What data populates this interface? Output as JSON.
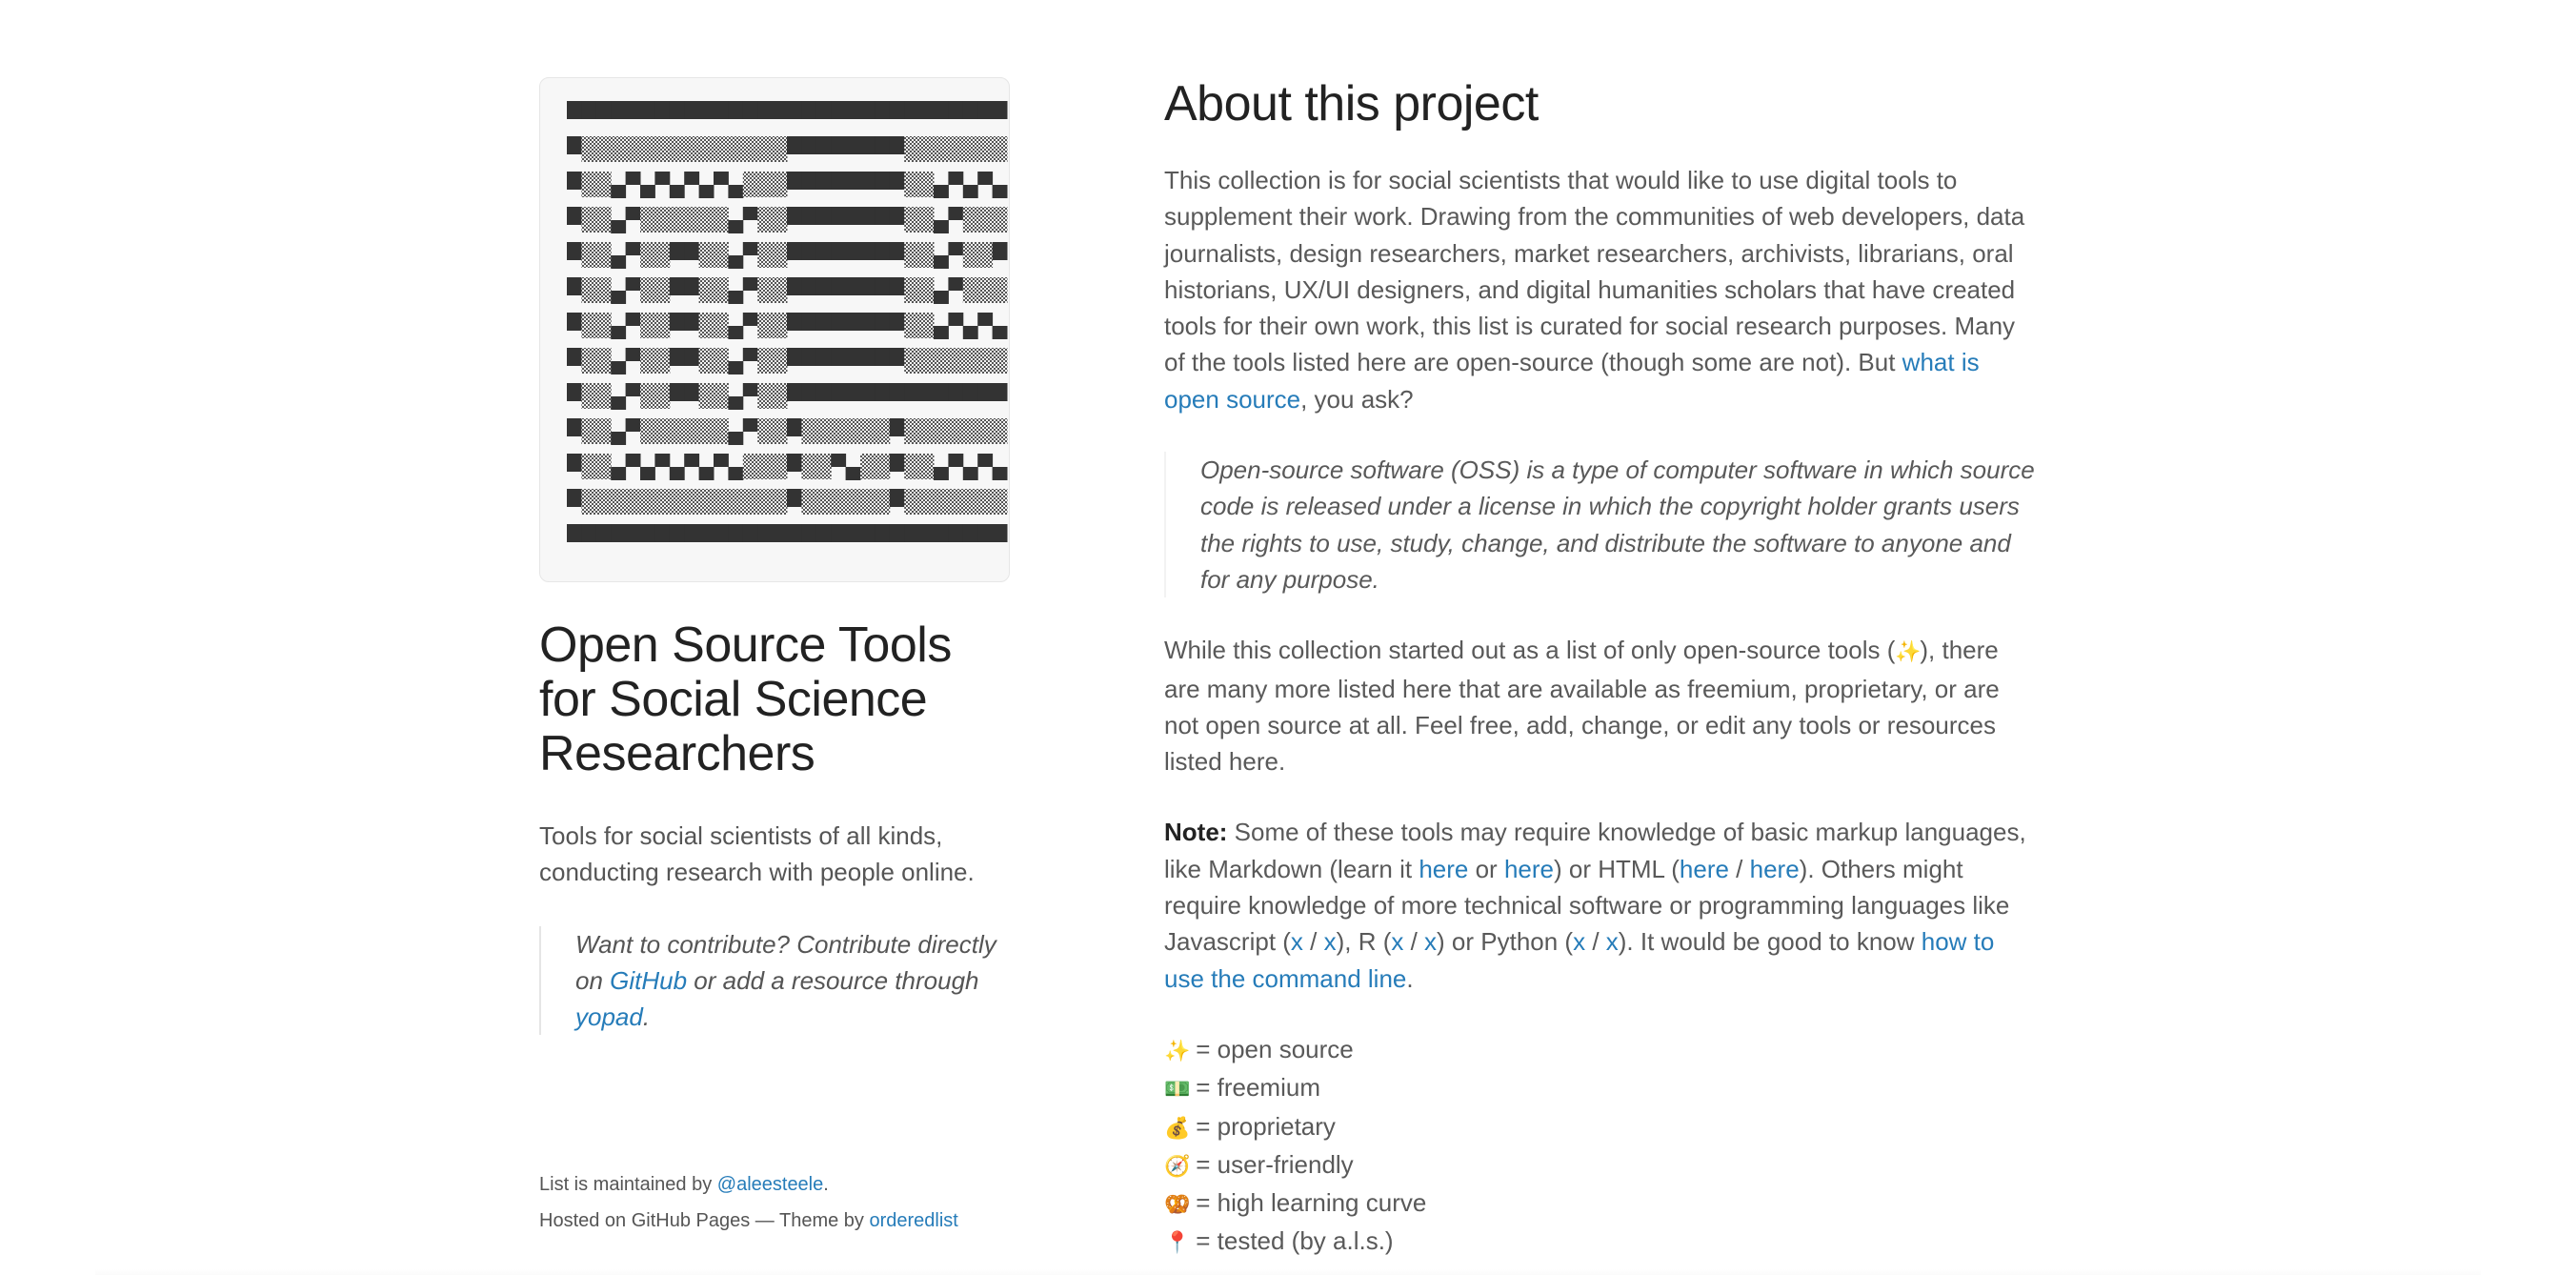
{
  "sidebar": {
    "logo_alt": "woven pattern logo",
    "title": "Open Source Tools for Social Science Researchers",
    "tagline": "Tools for social scientists of all kinds, conducting research with people online.",
    "contribute": {
      "text_before": "Want to contribute? Contribute directly on ",
      "github_link": "GitHub",
      "text_middle": " or add a resource through ",
      "yopad_link": "yopad",
      "text_after": "."
    },
    "footer": {
      "maintained_prefix": "List is maintained by ",
      "maintainer_link": "@aleesteele",
      "maintained_suffix": ".",
      "hosted_prefix": "Hosted on GitHub Pages — Theme by ",
      "theme_link": "orderedlist"
    }
  },
  "main": {
    "title": "About this project",
    "intro": {
      "text": "This collection is for social scientists that would like to use digital tools to supplement their work. Drawing from the communities of web developers, data journalists, design researchers, market researchers, archivists, librarians, oral historians, UX/UI designers, and digital humanities scholars that have created tools for their own work, this list is curated for social research purposes. Many of the tools listed here are open-source (though some are not). But ",
      "link": "what is open source",
      "after": ", you ask?"
    },
    "quote": "Open-source software (OSS) is a type of computer software in which source code is released under a license in which the copyright holder grants users the rights to use, study, change, and distribute the software to anyone and for any purpose.",
    "collection": {
      "before": "While this collection started out as a list of only open-source tools (",
      "emoji": "✨",
      "after": "), there are many more listed here that are available as freemium, proprietary, or are not open source at all. Feel free, add, change, or edit any tools or resources listed here."
    },
    "note": {
      "label": "Note:",
      "t1": " Some of these tools may require knowledge of basic markup languages, like Markdown (learn it ",
      "l1": "here",
      "t2": " or ",
      "l2": "here",
      "t3": ") or HTML (",
      "l3": "here",
      "t4": " / ",
      "l4": "here",
      "t5": "). Others might require knowledge of more technical software or programming languages like Javascript (",
      "js1": "x",
      "sep1": " / ",
      "js2": "x",
      "t6": "), R (",
      "r1": "x",
      "sep2": " / ",
      "r2": "x",
      "t7": ") or Python (",
      "py1": "x",
      "sep3": " / ",
      "py2": "x",
      "t8": "). It would be good to know ",
      "cmd_link": "how to use the command line",
      "t9": "."
    },
    "legend": [
      {
        "icon": "sparkles-icon",
        "emoji": "✨",
        "label": " = open source"
      },
      {
        "icon": "dollar-banknote-icon",
        "emoji": "💵",
        "label": " = freemium"
      },
      {
        "icon": "money-bag-icon",
        "emoji": "💰",
        "label": " = proprietary"
      },
      {
        "icon": "compass-icon",
        "emoji": "🧭",
        "label": " = user-friendly"
      },
      {
        "icon": "pretzel-icon",
        "emoji": "🥨",
        "label": " = high learning curve"
      },
      {
        "icon": "pushpin-icon",
        "emoji": "📍",
        "label": " = tested (by a.l.s.)"
      }
    ]
  },
  "colors": {
    "link": "#267CB9",
    "heading": "#222222",
    "body": "#595959",
    "logo_dark": "#333333",
    "logo_bg": "#F7F7F7"
  }
}
